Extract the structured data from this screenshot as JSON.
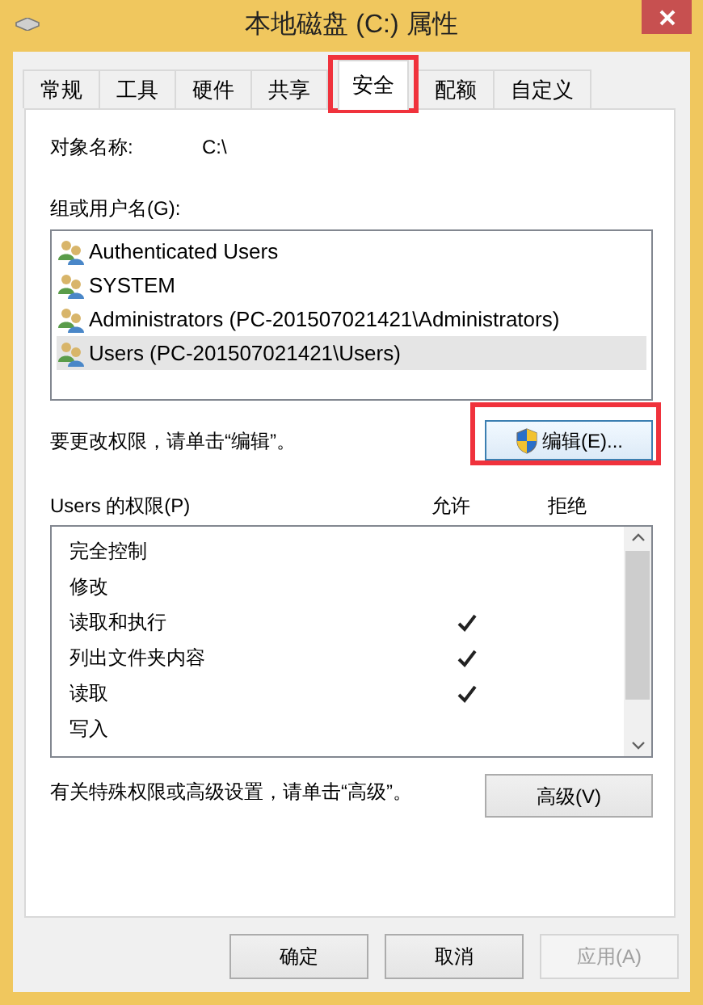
{
  "window": {
    "title": "本地磁盘 (C:) 属性"
  },
  "tabs": [
    {
      "label": "常规",
      "selected": false
    },
    {
      "label": "工具",
      "selected": false
    },
    {
      "label": "硬件",
      "selected": false
    },
    {
      "label": "共享",
      "selected": false
    },
    {
      "label": "安全",
      "selected": true,
      "highlighted": true
    },
    {
      "label": "配额",
      "selected": false
    },
    {
      "label": "自定义",
      "selected": false
    }
  ],
  "object_name": {
    "label": "对象名称:",
    "value": "C:\\"
  },
  "groups": {
    "label": "组或用户名(G):",
    "items": [
      {
        "name": "Authenticated Users",
        "selected": false
      },
      {
        "name": "SYSTEM",
        "selected": false
      },
      {
        "name": "Administrators (PC-201507021421\\Administrators)",
        "selected": false
      },
      {
        "name": "Users (PC-201507021421\\Users)",
        "selected": true
      }
    ]
  },
  "edit_hint": "要更改权限，请单击“编辑”。",
  "edit_button": {
    "label": "编辑(E)...",
    "highlighted": true
  },
  "permissions": {
    "label": "Users 的权限(P)",
    "allow_header": "允许",
    "deny_header": "拒绝",
    "rows": [
      {
        "name": "完全控制",
        "allow": false,
        "deny": false
      },
      {
        "name": "修改",
        "allow": false,
        "deny": false
      },
      {
        "name": "读取和执行",
        "allow": true,
        "deny": false
      },
      {
        "name": "列出文件夹内容",
        "allow": true,
        "deny": false
      },
      {
        "name": "读取",
        "allow": true,
        "deny": false
      },
      {
        "name": "写入",
        "allow": false,
        "deny": false
      }
    ]
  },
  "advanced_hint": "有关特殊权限或高级设置，请单击“高级”。",
  "advanced_button": "高级(V)",
  "buttons": [
    {
      "label": "确定",
      "disabled": false
    },
    {
      "label": "取消",
      "disabled": false
    },
    {
      "label": "应用(A)",
      "disabled": true
    }
  ]
}
